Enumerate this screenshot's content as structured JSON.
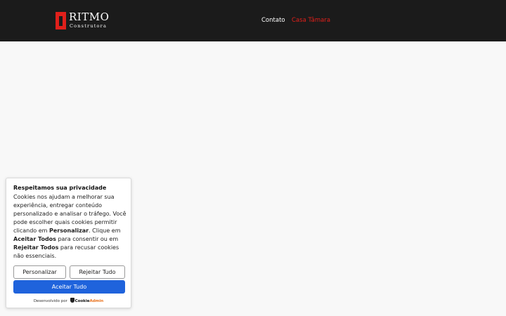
{
  "header": {
    "logo": {
      "name": "RITMO",
      "subtitle": "Construtora"
    },
    "nav": [
      {
        "label": "Contato",
        "color": "#ffffff"
      },
      {
        "label": "Casa Tâmara",
        "color": "#e0201b"
      }
    ]
  },
  "cookie_banner": {
    "title": "Respeitamos sua privacidade",
    "text": {
      "part1": "Cookies nos ajudam a melhorar sua experiência, entregar conteúdo personalizado e analisar o tráfego. Você pode escolher quais cookies permitir clicando em ",
      "bold1": "Personalizar",
      "part2": ". Clique em ",
      "bold2": "Aceitar Todos",
      "part3": " para consentir ou em ",
      "bold3": "Rejeitar Todos",
      "part4": " para recusar cookies não essenciais."
    },
    "buttons": {
      "customize": "Personalizar",
      "reject": "Rejeitar Tudo",
      "accept": "Aceitar Tudo"
    },
    "powered_by": {
      "prefix": "Desenvolvido por",
      "brand": "Cookie",
      "brand_accent": "Admin"
    },
    "accent_color": "#1f63dc"
  }
}
